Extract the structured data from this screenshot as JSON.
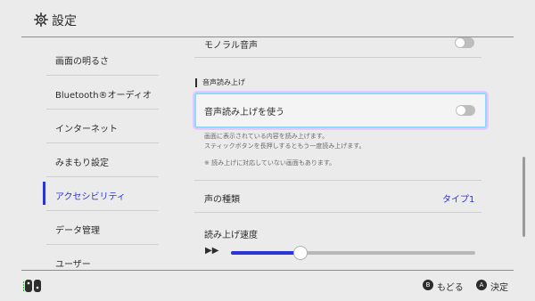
{
  "header": {
    "title": "設定",
    "icon": "gear-icon"
  },
  "sidebar": {
    "items": [
      {
        "label": "画面の明るさ",
        "active": false
      },
      {
        "label": "Bluetooth®オーディオ",
        "active": false
      },
      {
        "label": "インターネット",
        "active": false
      },
      {
        "label": "みまもり設定",
        "active": false
      },
      {
        "label": "アクセシビリティ",
        "active": true
      },
      {
        "label": "データ管理",
        "active": false
      },
      {
        "label": "ユーザー",
        "active": false
      }
    ]
  },
  "main": {
    "mono": {
      "label": "モノラル音声",
      "toggle": "off"
    },
    "section_title": "音声読み上げ",
    "tts": {
      "label": "音声読み上げを使う",
      "toggle": "off",
      "desc_line1": "画面に表示されている内容を読み上げます。",
      "desc_line2": "スティックボタンを長押しするともう一度読み上げます。",
      "note": "※ 読み上げに対応していない画面もあります。"
    },
    "voice": {
      "label": "声の種類",
      "value": "タイプ1"
    },
    "speed": {
      "label": "読み上げ速度",
      "icon": "fast-forward-icon",
      "level": 0.28
    }
  },
  "footer": {
    "back": {
      "button": "B",
      "label": "もどる"
    },
    "ok": {
      "button": "A",
      "label": "決定"
    }
  },
  "colors": {
    "accent": "#2b35d6",
    "focus_glow": "#8fd8ff",
    "background": "#ebebeb"
  }
}
